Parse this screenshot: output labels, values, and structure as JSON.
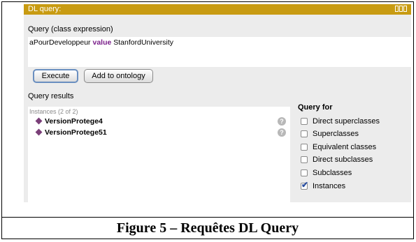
{
  "window": {
    "title": "DL query:"
  },
  "query": {
    "section_label": "Query (class expression)",
    "expression": {
      "part1": "aPourDeveloppeur",
      "keyword": "value",
      "part2": "StanfordUniversity"
    }
  },
  "buttons": {
    "execute": "Execute",
    "add_to_ontology": "Add to ontology"
  },
  "results": {
    "section_label": "Query results",
    "header": "Instances (2 of 2)",
    "items": [
      {
        "name": "VersionProtege4"
      },
      {
        "name": "VersionProtege51"
      }
    ],
    "help_glyph": "?"
  },
  "query_for": {
    "label": "Query for",
    "options": [
      {
        "label": "Direct superclasses",
        "checked": false
      },
      {
        "label": "Superclasses",
        "checked": false
      },
      {
        "label": "Equivalent classes",
        "checked": false
      },
      {
        "label": "Direct subclasses",
        "checked": false
      },
      {
        "label": "Subclasses",
        "checked": false
      },
      {
        "label": "Instances",
        "checked": true
      }
    ],
    "check_glyph": "✔"
  },
  "caption": "Figure 5 – Requêtes DL Query",
  "colors": {
    "titlebar": "#c89b12",
    "keyword": "#7a1f8a",
    "individual": "#7a3f78"
  }
}
